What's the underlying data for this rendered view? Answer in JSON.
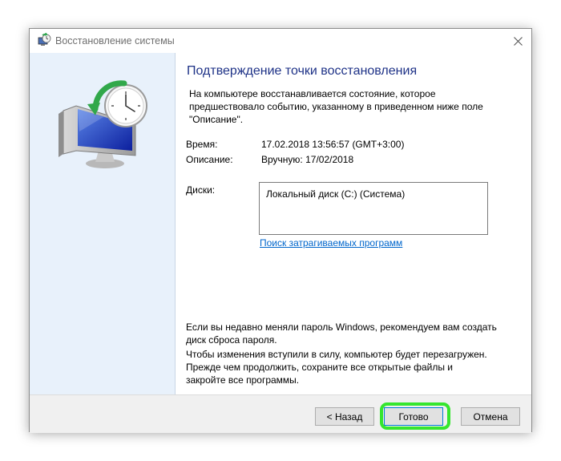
{
  "window": {
    "title": "Восстановление системы"
  },
  "main": {
    "heading": "Подтверждение точки восстановления",
    "intro_lines": [
      "На компьютере восстанавливается состояние, которое",
      "предшествовало событию, указанному в приведенном ниже поле",
      "\"Описание\"."
    ],
    "time_label": "Время:",
    "time_value": "17.02.2018 13:56:57 (GMT+3:00)",
    "description_label": "Описание:",
    "description_value": "Вручную: 17/02/2018",
    "disks_label": "Диски:",
    "disks": [
      "Локальный диск (C:) (Система)"
    ],
    "affected_link": "Поиск затрагиваемых программ",
    "password_note_lines": [
      "Если вы недавно меняли пароль Windows, рекомендуем вам создать",
      "диск сброса пароля."
    ],
    "restart_note_lines": [
      "Чтобы изменения вступили в силу, компьютер будет перезагружен.",
      "Прежде чем продолжить, сохраните все открытые файлы и",
      "закройте все программы."
    ]
  },
  "footer": {
    "back_label": "< Назад",
    "finish_label": "Готово",
    "cancel_label": "Отмена"
  },
  "colors": {
    "heading": "#1e3287",
    "link": "#0066cc",
    "highlight": "#35e62e",
    "sidebar": "#e8f1fb"
  },
  "icons": {
    "title": "system-restore-icon",
    "hero": "monitor-clock-restore-icon",
    "close": "close-icon"
  }
}
